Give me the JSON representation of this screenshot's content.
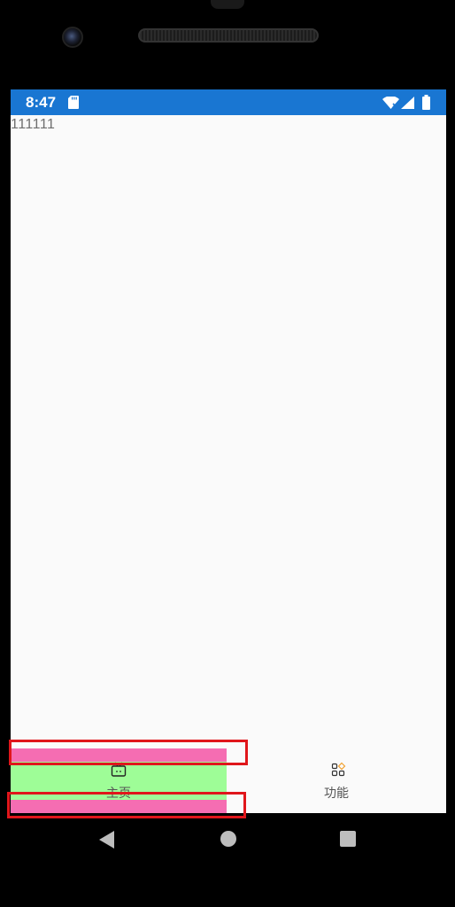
{
  "status_bar": {
    "time": "8:47",
    "background_color": "#1976d2"
  },
  "content": {
    "text": "111111"
  },
  "tabs": [
    {
      "label": "主页",
      "icon": "home-tv-icon",
      "selected": true
    },
    {
      "label": "功能",
      "icon": "grid-apps-icon",
      "selected": false
    }
  ],
  "colors": {
    "tab_highlight_green": "#9efd97",
    "tab_highlight_pink": "#f56db2",
    "annotation_red": "#e0161b"
  },
  "nav_bar": {
    "back": "back-icon",
    "home": "home-icon",
    "recents": "recents-icon"
  }
}
